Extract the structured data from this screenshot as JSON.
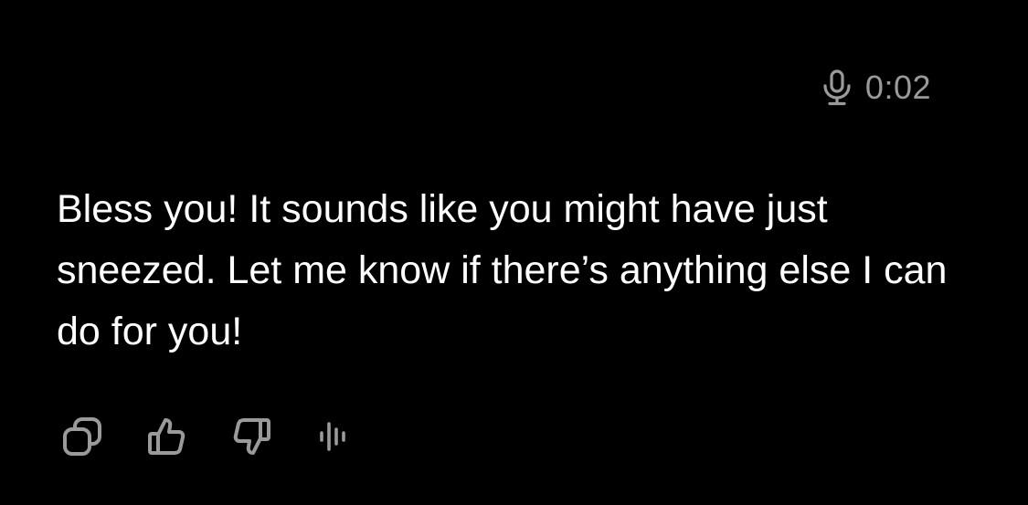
{
  "voice": {
    "icon": "microphone-icon",
    "duration": "0:02"
  },
  "message": {
    "text": "Bless you! It sounds like you might have just sneezed. Let me know if there’s anything else I can do for you!"
  },
  "actions": {
    "items": [
      {
        "name": "copy",
        "icon": "copy-icon"
      },
      {
        "name": "thumbs-up",
        "icon": "thumbs-up-icon"
      },
      {
        "name": "thumbs-down",
        "icon": "thumbs-down-icon"
      },
      {
        "name": "read-aloud",
        "icon": "audio-waveform-icon"
      }
    ]
  },
  "colors": {
    "background": "#000000",
    "text": "#ffffff",
    "muted": "#9a9a9a"
  }
}
